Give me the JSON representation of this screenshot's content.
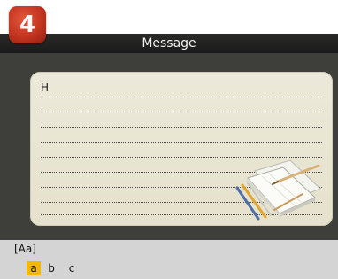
{
  "header": {
    "step_number": "4",
    "title": "Message"
  },
  "message": {
    "text": "H"
  },
  "input_method": {
    "mode": "[Aa]",
    "candidates": [
      "a",
      "b",
      "c"
    ],
    "selected_index": 0
  },
  "colors": {
    "badge": "#c33420",
    "highlight": "#f5b800",
    "screen_bg": "#3e3f3a",
    "paper_bg": "#e8e5d2"
  },
  "icons": {
    "notebook": "notebook-with-pencils-icon"
  }
}
